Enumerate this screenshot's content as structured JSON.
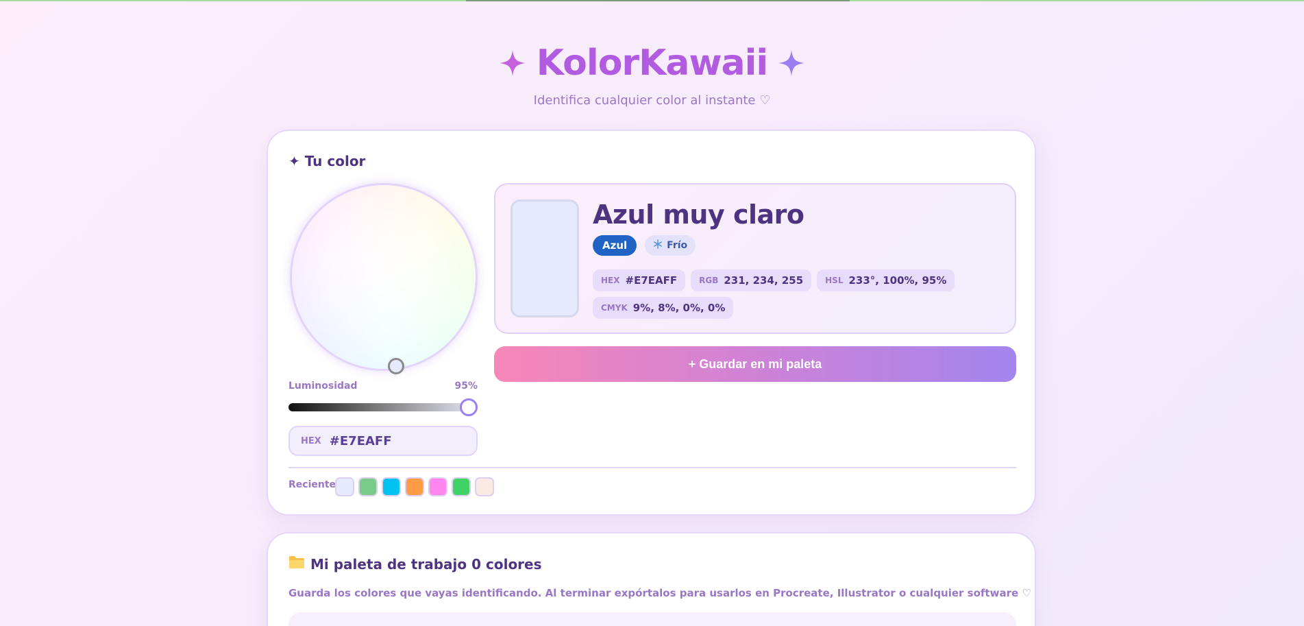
{
  "app": {
    "title": "KolorKawaii",
    "subtitle": "Identifica cualquier color al instante ♡",
    "accent_color": "#b15ce0"
  },
  "picker": {
    "section_title": "✦ Tu color",
    "luminosity_label": "Luminosidad",
    "luminosity_value": "95%",
    "luminosity_level": 0.95,
    "hex_label": "HEX",
    "hex_value": "#E7EAFF"
  },
  "color_info": {
    "name": "Azul muy claro",
    "swatch_color": "#E7EAFF",
    "family_tag": "Azul",
    "temperature_icon": "snowflake-icon",
    "temperature_tag": "Frío",
    "values": [
      {
        "label": "HEX",
        "value": "#E7EAFF"
      },
      {
        "label": "RGB",
        "value": "231, 234, 255"
      },
      {
        "label": "HSL",
        "value": "233°, 100%, 95%"
      },
      {
        "label": "CMYK",
        "value": "9%, 8%, 0%, 0%"
      }
    ]
  },
  "save_button_label": "+ Guardar en mi paleta",
  "recent": {
    "label": "Recientes",
    "colors": [
      "#E7EAFF",
      "#7ACB8A",
      "#00C2F0",
      "#FF9A45",
      "#FF85F0",
      "#3FD365",
      "#FBEAE4"
    ]
  },
  "palette": {
    "icon": "folder-icon",
    "title": "Mi paleta de trabajo 0 colores",
    "description": "Guarda los colores que vayas identificando. Al terminar expórtalos para usarlos en Procreate, Illustrator o cualquier software ♡"
  }
}
